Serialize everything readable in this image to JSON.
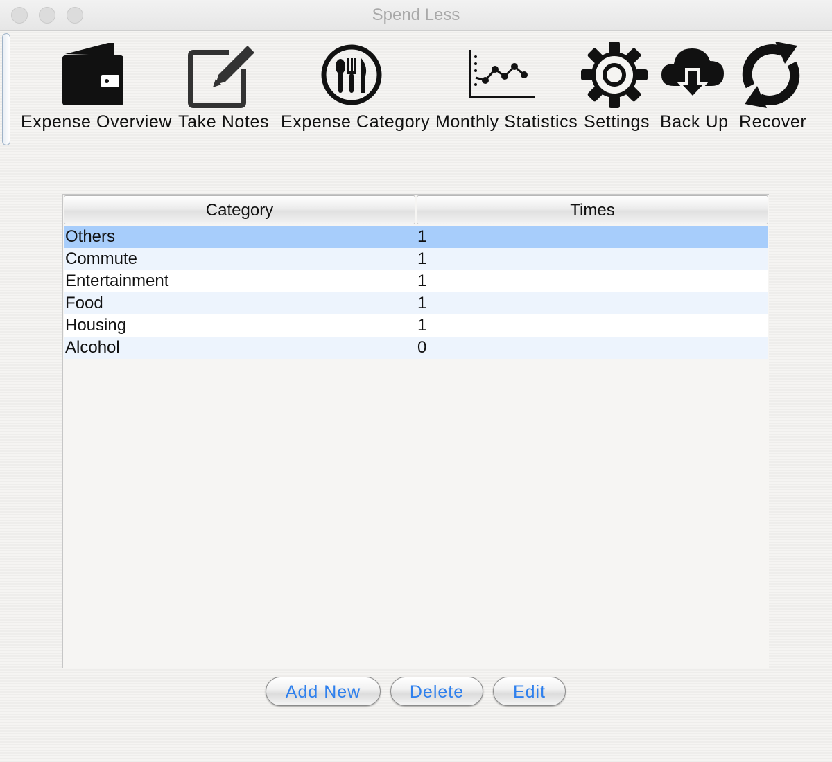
{
  "window": {
    "title": "Spend Less"
  },
  "toolbar": {
    "items": [
      {
        "label": "Expense Overview",
        "icon": "wallet-icon"
      },
      {
        "label": "Take Notes",
        "icon": "notes-edit-icon"
      },
      {
        "label": "Expense Category",
        "icon": "dining-cutlery-icon"
      },
      {
        "label": "Monthly Statistics",
        "icon": "line-chart-icon"
      },
      {
        "label": "Settings",
        "icon": "gear-icon"
      },
      {
        "label": "Back Up",
        "icon": "cloud-download-icon"
      },
      {
        "label": "Recover",
        "icon": "refresh-icon"
      }
    ]
  },
  "table": {
    "columns": [
      "Category",
      "Times"
    ],
    "rows": [
      {
        "category": "Others",
        "times": "1",
        "selected": true
      },
      {
        "category": "Commute",
        "times": "1"
      },
      {
        "category": "Entertainment",
        "times": "1"
      },
      {
        "category": "Food",
        "times": "1"
      },
      {
        "category": "Housing",
        "times": "1"
      },
      {
        "category": "Alcohol",
        "times": "0"
      }
    ]
  },
  "buttons": {
    "add_new": "Add New",
    "delete": "Delete",
    "edit": "Edit"
  },
  "colors": {
    "selection": "#a7cdfb",
    "stripe": "#edf4fd",
    "button_text": "#2f80ed"
  }
}
